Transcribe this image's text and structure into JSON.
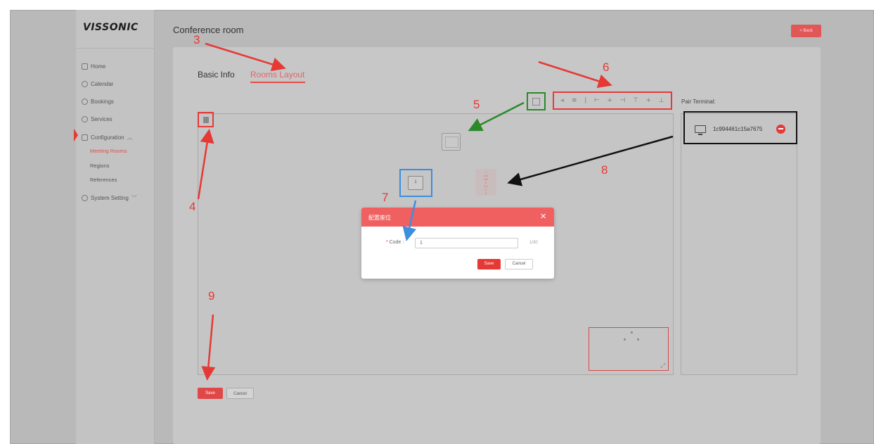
{
  "app": {
    "logo": "VISSONIC",
    "page_title": "Conference room",
    "back_label": "< Back"
  },
  "sidebar": {
    "items": [
      {
        "label": "Home",
        "icon": "home-icon"
      },
      {
        "label": "Calendar",
        "icon": "calendar-icon"
      },
      {
        "label": "Bookings",
        "icon": "bookings-icon"
      },
      {
        "label": "Services",
        "icon": "services-icon"
      },
      {
        "label": "Configuration",
        "icon": "configuration-icon",
        "expanded": true
      },
      {
        "label": "System Setting",
        "icon": "settings-icon"
      }
    ],
    "sub_items": [
      {
        "label": "Meeting Rooms",
        "active": true
      },
      {
        "label": "Regions"
      },
      {
        "label": "References"
      }
    ]
  },
  "tabs": [
    {
      "label": "Basic Info",
      "active": false
    },
    {
      "label": "Rooms Layout",
      "active": true
    }
  ],
  "toolbar": {
    "icons": [
      "align-left-icon",
      "align-center-icon",
      "align-right-icon",
      "distribute-h-icon",
      "align-middle-icon",
      "distribute-v-icon",
      "align-top-icon",
      "align-vcenter-icon",
      "align-bottom-icon"
    ]
  },
  "pair_terminal": {
    "label": "Pair Terminal:",
    "terminals": [
      {
        "id": "1c994461c15a7675"
      }
    ]
  },
  "canvas": {
    "seat_label": "1",
    "node_text": "1\n1a4\n4d0\n6\n1c1\n5\n6"
  },
  "dialog": {
    "title": "配置座位",
    "code_label": "Code",
    "code_value": "1",
    "counter": "1/30",
    "save_label": "Save",
    "cancel_label": "Cancel"
  },
  "footer": {
    "save_label": "Save",
    "cancel_label": "Cancel"
  },
  "annotations": [
    "3",
    "4",
    "5",
    "6",
    "7",
    "8",
    "9"
  ],
  "colors": {
    "accent": "#e53935",
    "green_marker": "#2a8a2a",
    "blue_marker": "#3b8ee0"
  }
}
